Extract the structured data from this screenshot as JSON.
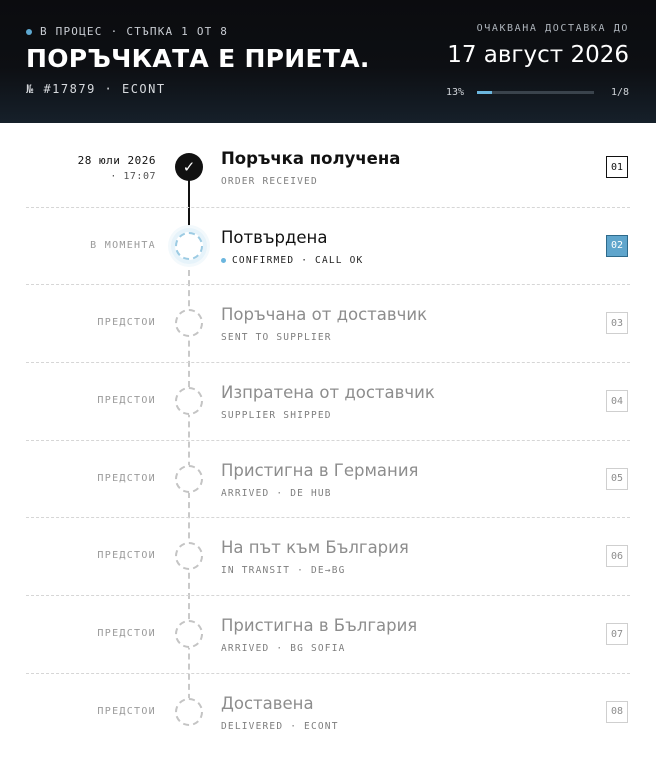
{
  "header": {
    "status": "В ПРОЦЕС",
    "step_label": "СТЪПКА 1 ОТ 8",
    "title": "ПОРЪЧКАТА Е ПРИЕТА.",
    "order_number": "№ #17879",
    "carrier": "ECONT",
    "eta_label": "ОЧАКВАНА ДОСТАВКА ДО",
    "eta_date": "17 август 2026",
    "progress_pct": "13%",
    "progress_count": "1/8",
    "progress_fraction": 0.13
  },
  "colors": {
    "accent": "#5fa5cc",
    "done": "#111111",
    "pending": "#8d8d8d"
  },
  "steps": [
    {
      "state": "done",
      "time": "28 юли 2026",
      "time_sub": "· 17:07",
      "title": "Поръчка получена",
      "sub": "ORDER RECEIVED",
      "num": "01",
      "icon": "check-icon"
    },
    {
      "state": "current",
      "time": "В МОМЕНТА",
      "title": "Потвърдена",
      "sub": "CONFIRMED · CALL OK",
      "num": "02"
    },
    {
      "state": "pending",
      "time": "ПРЕДСТОИ",
      "title": "Поръчана от доставчик",
      "sub": "SENT TO SUPPLIER",
      "num": "03"
    },
    {
      "state": "pending",
      "time": "ПРЕДСТОИ",
      "title": "Изпратена от доставчик",
      "sub": "SUPPLIER SHIPPED",
      "num": "04"
    },
    {
      "state": "pending",
      "time": "ПРЕДСТОИ",
      "title": "Пристигна в Германия",
      "sub": "ARRIVED · DE HUB",
      "num": "05"
    },
    {
      "state": "pending",
      "time": "ПРЕДСТОИ",
      "title": "На път към България",
      "sub": "IN TRANSIT · DE→BG",
      "num": "06"
    },
    {
      "state": "pending",
      "time": "ПРЕДСТОИ",
      "title": "Пристигна в България",
      "sub": "ARRIVED · BG SOFIA",
      "num": "07"
    },
    {
      "state": "pending",
      "time": "ПРЕДСТОИ",
      "title": "Доставена",
      "sub": "DELIVERED · ECONT",
      "num": "08"
    }
  ]
}
